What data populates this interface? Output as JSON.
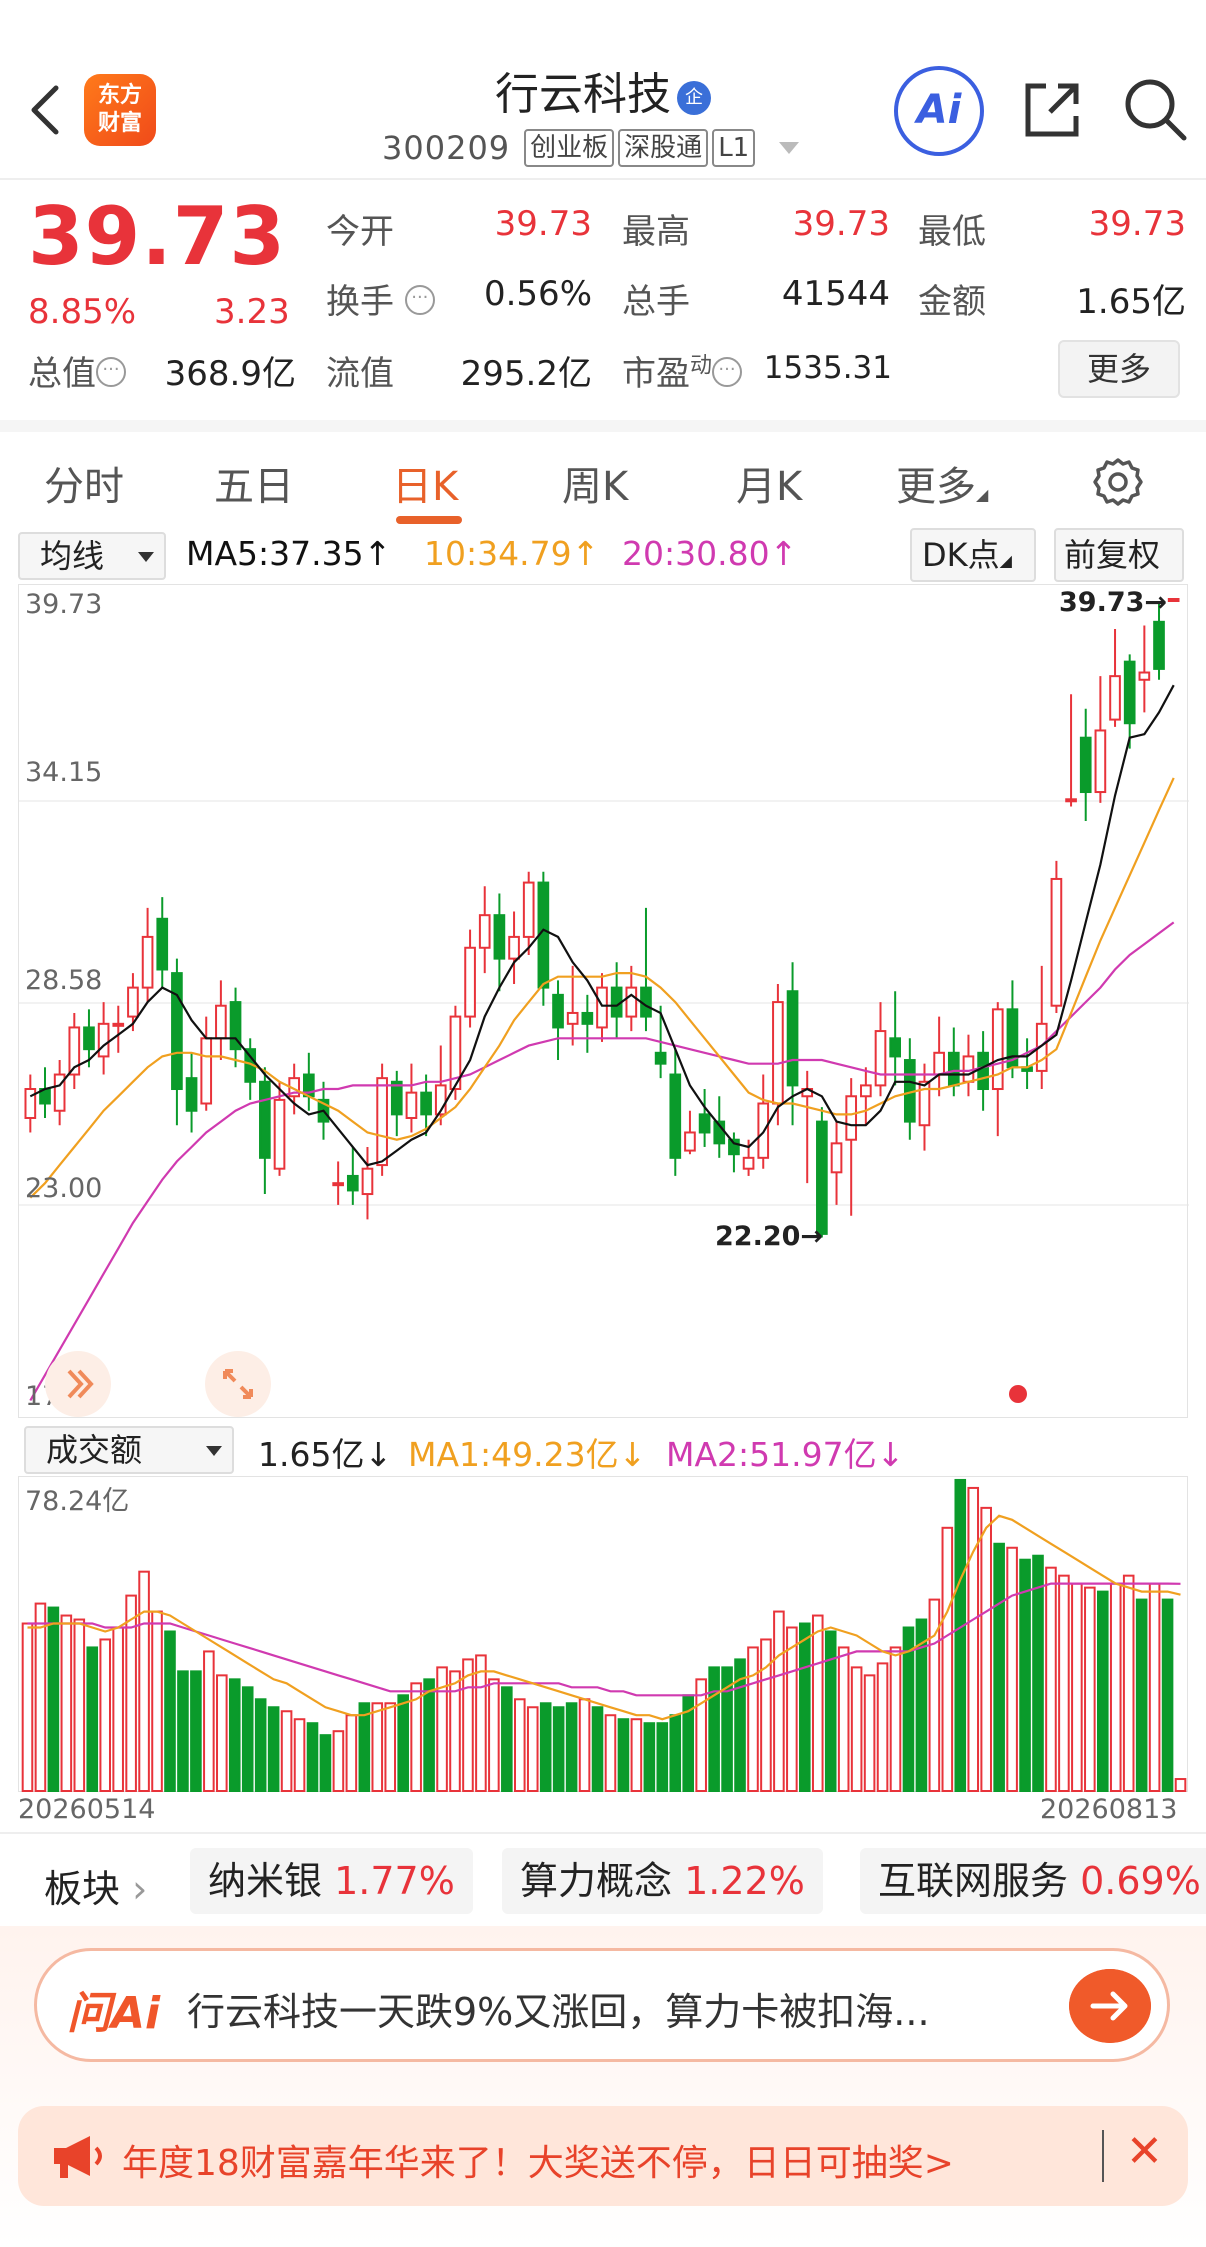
{
  "header": {
    "logo_text": [
      "东方",
      "财富"
    ],
    "stock_name": "行云科技",
    "enterprise_badge": "企",
    "code": "300209",
    "tags": [
      "创业板",
      "深股通",
      "L1"
    ],
    "ai_label": "Ai"
  },
  "quote": {
    "price": "39.73",
    "change_pct": "8.85%",
    "change_amt": "3.23",
    "fields": [
      {
        "label": "今开",
        "value": "39.73",
        "color": "#e8333a"
      },
      {
        "label": "最高",
        "value": "39.73",
        "color": "#e8333a"
      },
      {
        "label": "最低",
        "value": "39.73",
        "color": "#e8333a"
      },
      {
        "label": "换手",
        "value": "0.56%",
        "color": "#222222"
      },
      {
        "label": "总手",
        "value": "41544",
        "color": "#222222"
      },
      {
        "label": "金额",
        "value": "1.65亿",
        "color": "#222222"
      },
      {
        "label": "总值",
        "value": "368.9亿",
        "color": "#222222"
      },
      {
        "label": "流值",
        "value": "295.2亿",
        "color": "#222222"
      },
      {
        "label": "市盈",
        "value": "1535.31",
        "color": "#222222"
      }
    ],
    "pe_superscript": "动",
    "more_label": "更多"
  },
  "tabs": [
    "分时",
    "五日",
    "日K",
    "周K",
    "月K",
    "更多"
  ],
  "active_tab": "日K",
  "indicator": {
    "ma_select": "均线",
    "ma5": "MA5:37.35↑",
    "ma10": "10:34.79↑",
    "ma20": "20:30.80↑",
    "dk_label": "DK点",
    "adjust_label": "前复权",
    "vol_select": "成交额",
    "vol_value": "1.65亿↓",
    "vol_ma1": "MA1:49.23亿↓",
    "vol_ma2": "MA2:51.97亿↓"
  },
  "colors": {
    "up": "#e8333a",
    "down": "#0a9b2b",
    "ma5": "#111111",
    "ma10": "#f0a020",
    "ma20": "#d03ab0",
    "accent": "#e8612a"
  },
  "chart_data": {
    "type": "candlestick",
    "y_tick_labels": [
      "39.73",
      "34.15",
      "28.58",
      "23.00",
      "17.42"
    ],
    "ylim": [
      17.42,
      39.73
    ],
    "high_label": "39.73→",
    "low_label": "22.20→",
    "volume_max_label": "78.24亿",
    "start_date": "20260514",
    "end_date": "20260813",
    "candles": [
      [
        25.4,
        26.2,
        26.6,
        25.0
      ],
      [
        26.2,
        25.8,
        26.8,
        25.4
      ],
      [
        25.6,
        26.6,
        27.0,
        25.2
      ],
      [
        26.6,
        27.9,
        28.3,
        26.2
      ],
      [
        27.9,
        27.3,
        28.4,
        26.8
      ],
      [
        27.1,
        28.0,
        28.6,
        26.6
      ],
      [
        28.0,
        28.0,
        28.5,
        27.2
      ],
      [
        28.2,
        29.0,
        29.4,
        27.8
      ],
      [
        29.0,
        30.4,
        31.2,
        28.6
      ],
      [
        30.9,
        29.5,
        31.5,
        29.0
      ],
      [
        29.4,
        26.2,
        29.8,
        25.2
      ],
      [
        26.5,
        25.6,
        27.2,
        25.0
      ],
      [
        25.8,
        27.6,
        28.2,
        25.6
      ],
      [
        27.6,
        28.5,
        29.2,
        27.0
      ],
      [
        28.6,
        27.3,
        29.0,
        26.8
      ],
      [
        27.3,
        26.4,
        27.6,
        25.9
      ],
      [
        26.4,
        24.3,
        26.8,
        23.3
      ],
      [
        24.0,
        25.9,
        26.4,
        23.8
      ],
      [
        26.0,
        26.5,
        26.9,
        25.5
      ],
      [
        26.6,
        26.0,
        27.2,
        25.6
      ],
      [
        25.9,
        25.3,
        26.4,
        24.8
      ],
      [
        23.6,
        23.6,
        24.2,
        23.0
      ],
      [
        23.8,
        23.4,
        24.6,
        23.0
      ],
      [
        23.3,
        24.0,
        24.6,
        22.6
      ],
      [
        24.1,
        26.5,
        26.9,
        23.8
      ],
      [
        26.4,
        25.5,
        26.7,
        24.9
      ],
      [
        25.4,
        26.1,
        26.9,
        25.0
      ],
      [
        26.1,
        25.5,
        26.6,
        24.9
      ],
      [
        25.5,
        26.3,
        27.4,
        25.2
      ],
      [
        26.2,
        28.2,
        28.5,
        25.9
      ],
      [
        28.2,
        30.1,
        30.6,
        27.9
      ],
      [
        30.1,
        31.0,
        31.8,
        29.4
      ],
      [
        31.0,
        29.8,
        31.6,
        28.9
      ],
      [
        29.8,
        30.4,
        31.1,
        29.1
      ],
      [
        30.4,
        31.9,
        32.2,
        29.9
      ],
      [
        31.9,
        29.0,
        32.2,
        28.5
      ],
      [
        28.8,
        27.9,
        29.2,
        27.0
      ],
      [
        28.0,
        28.3,
        29.6,
        27.4
      ],
      [
        28.3,
        28.0,
        28.8,
        27.2
      ],
      [
        27.9,
        29.0,
        29.4,
        27.5
      ],
      [
        29.0,
        28.2,
        29.7,
        27.6
      ],
      [
        28.2,
        29.0,
        29.6,
        27.8
      ],
      [
        29.0,
        28.2,
        31.2,
        27.8
      ],
      [
        27.2,
        26.9,
        28.5,
        26.5
      ],
      [
        26.6,
        24.3,
        27.3,
        23.8
      ],
      [
        24.5,
        25.0,
        25.6,
        24.4
      ],
      [
        25.5,
        25.0,
        26.2,
        24.6
      ],
      [
        25.3,
        24.7,
        26.0,
        24.3
      ],
      [
        24.8,
        24.4,
        25.0,
        23.9
      ],
      [
        24.0,
        24.3,
        24.8,
        23.8
      ],
      [
        24.3,
        25.8,
        26.6,
        24.0
      ],
      [
        25.8,
        28.6,
        29.1,
        25.2
      ],
      [
        28.9,
        26.3,
        29.7,
        25.2
      ],
      [
        26.0,
        26.2,
        26.7,
        23.6
      ],
      [
        25.3,
        22.2,
        25.7,
        22.1
      ],
      [
        23.9,
        24.7,
        25.3,
        23.0
      ],
      [
        24.8,
        26.0,
        26.5,
        22.7
      ],
      [
        26.0,
        26.3,
        26.8,
        25.2
      ],
      [
        26.3,
        27.8,
        28.6,
        26.0
      ],
      [
        27.6,
        27.1,
        28.9,
        26.3
      ],
      [
        27.0,
        25.3,
        27.6,
        24.8
      ],
      [
        25.2,
        26.4,
        26.9,
        24.5
      ],
      [
        26.6,
        27.2,
        28.2,
        26.0
      ],
      [
        27.2,
        26.3,
        27.9,
        26.0
      ],
      [
        26.4,
        27.1,
        27.7,
        26.0
      ],
      [
        27.2,
        26.2,
        27.8,
        25.6
      ],
      [
        26.2,
        28.4,
        28.6,
        24.9
      ],
      [
        28.4,
        26.8,
        29.2,
        26.5
      ],
      [
        26.8,
        26.7,
        27.6,
        26.2
      ],
      [
        26.7,
        28.0,
        29.6,
        26.2
      ],
      [
        28.5,
        32.0,
        32.5,
        28.3
      ],
      [
        34.2,
        34.2,
        37.1,
        34.0
      ],
      [
        35.9,
        34.4,
        36.7,
        33.6
      ],
      [
        34.4,
        36.1,
        37.6,
        34.1
      ],
      [
        36.4,
        37.6,
        38.9,
        36.2
      ],
      [
        38.0,
        36.3,
        38.2,
        35.6
      ],
      [
        37.5,
        37.7,
        39.0,
        36.6
      ],
      [
        39.1,
        37.8,
        39.6,
        37.5
      ],
      [
        39.73,
        39.73,
        39.73,
        39.73
      ]
    ],
    "ma5_points": [
      26.0,
      26.2,
      26.3,
      26.8,
      27.0,
      27.4,
      27.7,
      28.0,
      28.6,
      29.0,
      28.8,
      28.1,
      27.6,
      27.6,
      27.6,
      27.1,
      26.6,
      26.2,
      25.8,
      25.5,
      25.6,
      25.1,
      24.6,
      24.1,
      24.2,
      24.5,
      24.8,
      25.0,
      25.6,
      26.3,
      27.0,
      28.2,
      29.0,
      29.7,
      30.1,
      30.6,
      30.4,
      29.7,
      29.2,
      28.5,
      28.5,
      28.8,
      28.5,
      28.3,
      27.3,
      26.3,
      25.7,
      25.2,
      24.7,
      24.6,
      25.0,
      25.7,
      26.0,
      26.2,
      26.0,
      25.3,
      25.2,
      25.2,
      25.6,
      26.4,
      26.4,
      26.3,
      26.6,
      26.6,
      26.6,
      26.8,
      27.0,
      27.1,
      27.1,
      27.4,
      27.7,
      29.2,
      30.8,
      32.4,
      34.3,
      35.9,
      36.0,
      36.6,
      37.35
    ],
    "ma10_points": [
      23.2,
      23.6,
      24.1,
      24.6,
      25.1,
      25.6,
      26.0,
      26.4,
      26.8,
      27.1,
      27.2,
      27.2,
      27.1,
      27.1,
      27.0,
      26.9,
      26.7,
      26.4,
      26.2,
      26.0,
      25.8,
      25.6,
      25.3,
      25.0,
      24.9,
      24.8,
      24.9,
      25.1,
      25.4,
      25.7,
      26.2,
      26.8,
      27.4,
      28.1,
      28.6,
      29.1,
      29.3,
      29.3,
      29.3,
      29.3,
      29.4,
      29.4,
      29.3,
      29.0,
      28.6,
      28.1,
      27.6,
      27.1,
      26.6,
      26.1,
      25.9,
      25.8,
      25.8,
      25.7,
      25.6,
      25.5,
      25.5,
      25.6,
      25.8,
      26.0,
      26.1,
      26.2,
      26.2,
      26.3,
      26.4,
      26.5,
      26.6,
      26.8,
      26.8,
      27.0,
      27.3,
      28.3,
      29.3,
      30.3,
      31.2,
      32.1,
      33.0,
      33.9,
      34.79
    ],
    "ma20_points": [
      17.6,
      18.3,
      19.0,
      19.7,
      20.4,
      21.1,
      21.8,
      22.5,
      23.1,
      23.7,
      24.2,
      24.6,
      25.0,
      25.3,
      25.6,
      25.8,
      25.9,
      26.0,
      26.1,
      26.1,
      26.2,
      26.2,
      26.3,
      26.3,
      26.3,
      26.3,
      26.3,
      26.4,
      26.4,
      26.5,
      26.6,
      26.8,
      27.0,
      27.2,
      27.4,
      27.5,
      27.6,
      27.6,
      27.6,
      27.6,
      27.6,
      27.6,
      27.6,
      27.5,
      27.4,
      27.3,
      27.2,
      27.1,
      27.0,
      26.9,
      26.9,
      26.9,
      27.0,
      27.0,
      27.0,
      26.9,
      26.8,
      26.7,
      26.6,
      26.6,
      26.6,
      26.6,
      26.6,
      26.7,
      26.7,
      26.8,
      26.9,
      27.0,
      27.2,
      27.4,
      27.8,
      28.2,
      28.6,
      29.0,
      29.5,
      29.9,
      30.2,
      30.5,
      30.8
    ],
    "volumes": [
      42,
      47,
      46,
      44,
      43,
      36,
      38,
      41,
      49,
      55,
      45,
      40,
      30,
      30,
      35,
      29,
      28,
      26,
      23,
      21,
      20,
      18,
      17,
      14,
      15,
      19,
      22,
      22,
      22,
      24,
      27,
      28,
      31,
      30,
      33,
      34,
      28,
      26,
      23,
      21,
      22,
      21,
      22,
      23,
      21,
      19,
      18,
      18,
      17,
      17,
      19,
      24,
      28,
      31,
      31,
      33,
      36,
      38,
      45,
      41,
      42,
      44,
      40,
      36,
      31,
      29,
      32,
      36,
      41,
      43,
      48,
      66,
      78,
      76,
      71,
      62,
      61,
      58,
      59,
      56,
      54,
      52,
      51,
      50,
      52,
      54,
      48,
      52,
      48,
      3
    ],
    "vol_ma1": [
      41,
      41,
      42,
      42,
      42,
      41,
      40,
      41,
      43,
      45,
      45,
      44,
      42,
      40,
      38,
      36,
      34,
      32,
      30,
      28,
      27,
      25,
      23,
      21,
      20,
      19,
      19,
      20,
      21,
      22,
      23,
      25,
      26,
      27,
      29,
      30,
      30,
      29,
      28,
      27,
      26,
      25,
      24,
      23,
      22,
      21,
      20,
      19,
      19,
      18,
      19,
      20,
      22,
      24,
      26,
      28,
      29,
      31,
      34,
      36,
      38,
      40,
      41,
      40,
      39,
      37,
      35,
      34,
      35,
      37,
      39,
      45,
      53,
      60,
      66,
      69,
      68,
      66,
      64,
      62,
      60,
      58,
      56,
      54,
      52,
      51,
      50,
      50,
      50,
      49.23
    ],
    "vol_ma2": [
      42,
      42,
      42,
      42,
      42,
      42,
      41,
      41,
      41,
      42,
      42,
      42,
      41,
      40,
      39,
      38,
      37,
      36,
      35,
      34,
      33,
      32,
      31,
      30,
      29,
      28,
      27,
      26,
      25,
      25,
      25,
      25,
      25,
      25,
      26,
      26,
      27,
      27,
      27,
      27,
      27,
      27,
      26,
      26,
      26,
      25,
      25,
      24,
      24,
      24,
      24,
      24,
      24,
      25,
      25,
      26,
      27,
      28,
      29,
      30,
      31,
      32,
      33,
      34,
      35,
      35,
      35,
      35,
      35,
      36,
      37,
      39,
      41,
      43,
      45,
      47,
      49,
      50,
      51,
      52,
      52,
      52,
      52,
      52,
      52,
      52,
      52,
      52,
      52,
      51.97
    ]
  },
  "sectors": {
    "title": "板块",
    "items": [
      {
        "name": "纳米银",
        "pct": "1.77%"
      },
      {
        "name": "算力概念",
        "pct": "1.22%"
      },
      {
        "name": "互联网服务",
        "pct": "0.69%"
      }
    ]
  },
  "ask_ai": {
    "logo": "问Ai",
    "question": "行云科技一天跌9%又涨回，算力卡被扣海..."
  },
  "banner": {
    "text": "年度18财富嘉年华来了！大奖送不停，日日可抽奖>"
  }
}
